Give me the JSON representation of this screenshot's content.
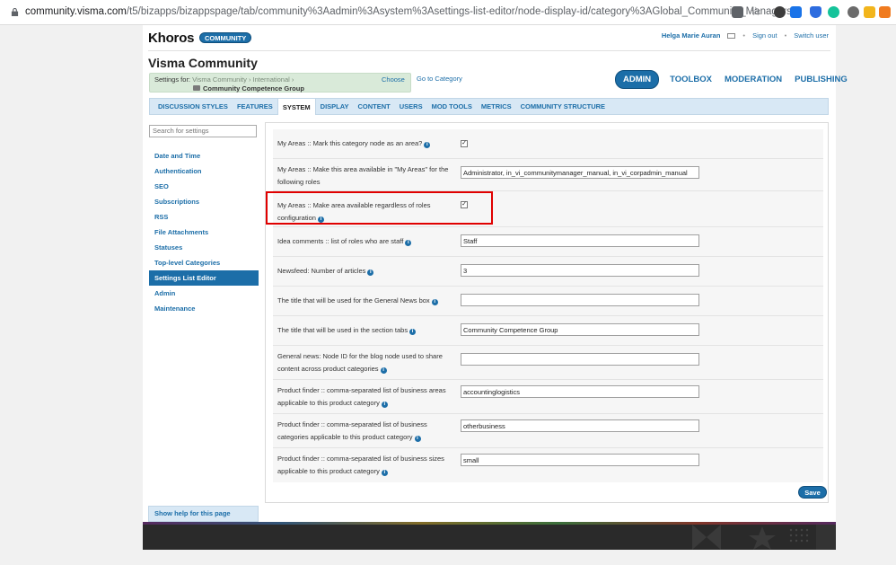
{
  "browser": {
    "url_domain": "community.visma.com",
    "url_path": "/t5/bizapps/bizappspage/tab/community%3Aadmin%3Asystem%3Asettings-list-editor/node-display-id/category%3AGlobal_Community_Managers"
  },
  "header": {
    "logo": "Khoros",
    "logo_badge": "COMMUNITY",
    "user_name": "Helga Marie Auran",
    "sign_out": "Sign out",
    "switch_user": "Switch user",
    "community_title": "Visma Community"
  },
  "settings_for": {
    "label": "Settings for:",
    "crumb1": "Visma Community",
    "crumb2": "International",
    "group": "Community Competence Group",
    "choose": "Choose",
    "go_to_category": "Go to Category"
  },
  "top_tabs": [
    "ADMIN",
    "TOOLBOX",
    "MODERATION",
    "PUBLISHING"
  ],
  "sub_nav": [
    "DISCUSSION STYLES",
    "FEATURES",
    "SYSTEM",
    "DISPLAY",
    "CONTENT",
    "USERS",
    "MOD TOOLS",
    "METRICS",
    "COMMUNITY STRUCTURE"
  ],
  "sidebar": {
    "search_placeholder": "Search for settings",
    "items": [
      "Date and Time",
      "Authentication",
      "SEO",
      "Subscriptions",
      "RSS",
      "File Attachments",
      "Statuses",
      "Top-level Categories",
      "Settings List Editor",
      "Admin",
      "Maintenance"
    ],
    "help": "Show help for this page"
  },
  "settings": [
    {
      "label": "My Areas :: Mark this category node as an area?",
      "type": "checkbox",
      "checked": true
    },
    {
      "label": "My Areas :: Make this area available in \"My Areas\" for the following roles",
      "type": "text",
      "value": "Administrator, in_vi_communitymanager_manual, in_vi_corpadmin_manual"
    },
    {
      "label": "My Areas :: Make area available regardless of roles configuration",
      "type": "checkbox",
      "checked": true
    },
    {
      "label": "Idea comments :: list of roles who are staff",
      "type": "text",
      "value": "Staff"
    },
    {
      "label": "Newsfeed: Number of articles",
      "type": "text",
      "value": "3"
    },
    {
      "label": "The title that will be used for the General News box",
      "type": "text",
      "value": ""
    },
    {
      "label": "The title that will be used in the section tabs",
      "type": "text",
      "value": "Community Competence Group"
    },
    {
      "label": "General news: Node ID for the blog node used to share content across product categories",
      "type": "text",
      "value": ""
    },
    {
      "label": "Product finder :: comma-separated list of business areas applicable to this product category",
      "type": "text",
      "value": "accountinglogistics"
    },
    {
      "label": "Product finder :: comma-separated list of business categories applicable to this product category",
      "type": "text",
      "value": "otherbusiness"
    },
    {
      "label": "Product finder :: comma-separated list of business sizes applicable to this product category",
      "type": "text",
      "value": "small"
    }
  ],
  "save": "Save"
}
